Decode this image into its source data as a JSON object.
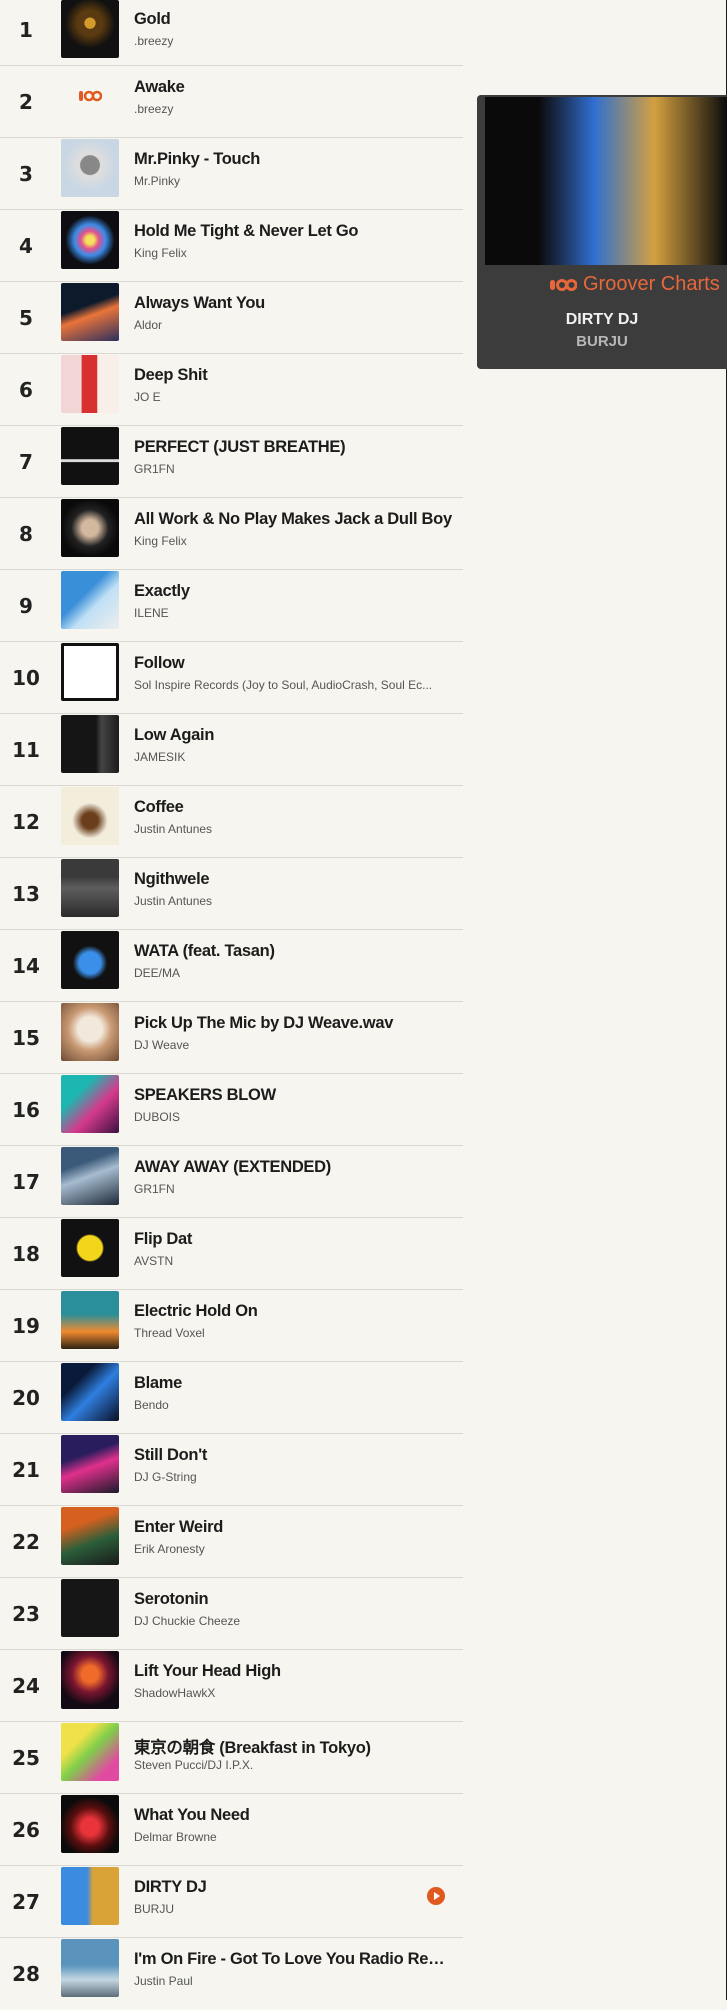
{
  "chart": {
    "tracks": [
      {
        "rank": "1",
        "title": "Gold",
        "artist": ".breezy"
      },
      {
        "rank": "2",
        "title": "Awake",
        "artist": ".breezy"
      },
      {
        "rank": "3",
        "title": "Mr.Pinky - Touch",
        "artist": "Mr.Pinky"
      },
      {
        "rank": "4",
        "title": "Hold Me Tight & Never Let Go",
        "artist": "King Felix"
      },
      {
        "rank": "5",
        "title": "Always Want You",
        "artist": "Aldor"
      },
      {
        "rank": "6",
        "title": "Deep Shit",
        "artist": "JO E"
      },
      {
        "rank": "7",
        "title": "PERFECT (JUST BREATHE)",
        "artist": "GR1FN"
      },
      {
        "rank": "8",
        "title": "All Work & No Play Makes Jack a Dull Boy",
        "artist": "King Felix"
      },
      {
        "rank": "9",
        "title": "Exactly",
        "artist": "ILENE"
      },
      {
        "rank": "10",
        "title": "Follow",
        "artist": "Sol Inspire Records (Joy to Soul, AudioCrash, Soul Ec..."
      },
      {
        "rank": "11",
        "title": "Low Again",
        "artist": "JAMESIK"
      },
      {
        "rank": "12",
        "title": "Coffee",
        "artist": "Justin Antunes"
      },
      {
        "rank": "13",
        "title": "Ngithwele",
        "artist": "Justin Antunes"
      },
      {
        "rank": "14",
        "title": "WATA (feat. Tasan)",
        "artist": "DEE/MA"
      },
      {
        "rank": "15",
        "title": "Pick Up The Mic by DJ Weave.wav",
        "artist": "DJ Weave"
      },
      {
        "rank": "16",
        "title": "SPEAKERS BLOW",
        "artist": "DUBOIS"
      },
      {
        "rank": "17",
        "title": "AWAY AWAY (EXTENDED)",
        "artist": "GR1FN"
      },
      {
        "rank": "18",
        "title": "Flip Dat",
        "artist": "AVSTN"
      },
      {
        "rank": "19",
        "title": "Electric Hold On",
        "artist": "Thread Voxel"
      },
      {
        "rank": "20",
        "title": "Blame",
        "artist": "Bendo"
      },
      {
        "rank": "21",
        "title": "Still Don't",
        "artist": "DJ G-String"
      },
      {
        "rank": "22",
        "title": "Enter Weird",
        "artist": "Erik Aronesty"
      },
      {
        "rank": "23",
        "title": "Serotonin",
        "artist": "DJ Chuckie Cheeze"
      },
      {
        "rank": "24",
        "title": "Lift Your Head High",
        "artist": "ShadowHawkX"
      },
      {
        "rank": "25",
        "title": "東京の朝食 (Breakfast in Tokyo)",
        "artist": "Steven Pucci/DJ I.P.X."
      },
      {
        "rank": "26",
        "title": "What You Need",
        "artist": "Delmar Browne"
      },
      {
        "rank": "27",
        "title": "DIRTY DJ",
        "artist": "BURJU",
        "playing": true
      },
      {
        "rank": "28",
        "title": "I'm On Fire - Got To Love You Radio Remix",
        "artist": "Justin Paul"
      }
    ]
  },
  "featured": {
    "brand": "Groover Charts",
    "title": "DIRTY DJ",
    "artist": "BURJU",
    "brand_color": "#e8673a"
  },
  "icons": {
    "play": "play-icon",
    "brand_logo": "groover-logo-icon"
  }
}
